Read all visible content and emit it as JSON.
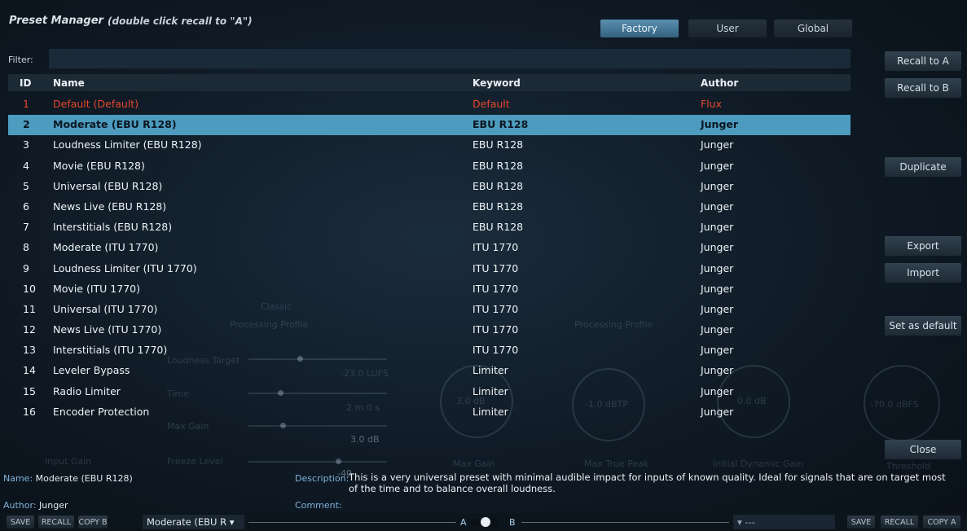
{
  "header": {
    "title": "Preset Manager",
    "subtitle": "(double click recall to \"A\")",
    "tabs": [
      {
        "label": "Factory",
        "active": true
      },
      {
        "label": "User",
        "active": false
      },
      {
        "label": "Global",
        "active": false
      }
    ]
  },
  "filter": {
    "label": "Filter:",
    "value": ""
  },
  "table": {
    "columns": {
      "id": "ID",
      "name": "Name",
      "keyword": "Keyword",
      "author": "Author"
    },
    "rows": [
      {
        "id": "1",
        "name": "Default (Default)",
        "keyword": "Default",
        "author": "Flux",
        "style": "red"
      },
      {
        "id": "2",
        "name": "Moderate (EBU R128)",
        "keyword": "EBU R128",
        "author": "Junger",
        "style": "selected"
      },
      {
        "id": "3",
        "name": "Loudness Limiter (EBU R128)",
        "keyword": "EBU R128",
        "author": "Junger",
        "style": ""
      },
      {
        "id": "4",
        "name": "Movie (EBU R128)",
        "keyword": "EBU R128",
        "author": "Junger",
        "style": ""
      },
      {
        "id": "5",
        "name": "Universal (EBU R128)",
        "keyword": "EBU R128",
        "author": "Junger",
        "style": ""
      },
      {
        "id": "6",
        "name": "News Live (EBU R128)",
        "keyword": "EBU R128",
        "author": "Junger",
        "style": ""
      },
      {
        "id": "7",
        "name": "Interstitials (EBU R128)",
        "keyword": "EBU R128",
        "author": "Junger",
        "style": ""
      },
      {
        "id": "8",
        "name": "Moderate (ITU 1770)",
        "keyword": "ITU 1770",
        "author": "Junger",
        "style": ""
      },
      {
        "id": "9",
        "name": "Loudness Limiter (ITU 1770)",
        "keyword": "ITU 1770",
        "author": "Junger",
        "style": ""
      },
      {
        "id": "10",
        "name": "Movie (ITU 1770)",
        "keyword": "ITU 1770",
        "author": "Junger",
        "style": ""
      },
      {
        "id": "11",
        "name": "Universal (ITU 1770)",
        "keyword": "ITU 1770",
        "author": "Junger",
        "style": ""
      },
      {
        "id": "12",
        "name": "News Live (ITU 1770)",
        "keyword": "ITU 1770",
        "author": "Junger",
        "style": ""
      },
      {
        "id": "13",
        "name": "Interstitials (ITU 1770)",
        "keyword": "ITU 1770",
        "author": "Junger",
        "style": ""
      },
      {
        "id": "14",
        "name": "Leveler Bypass",
        "keyword": "Limiter",
        "author": "Junger",
        "style": ""
      },
      {
        "id": "15",
        "name": "Radio Limiter",
        "keyword": "Limiter",
        "author": "Junger",
        "style": ""
      },
      {
        "id": "16",
        "name": "Encoder Protection",
        "keyword": "Limiter",
        "author": "Junger",
        "style": ""
      }
    ]
  },
  "side_buttons": {
    "recall_a": "Recall to A",
    "recall_b": "Recall to B",
    "duplicate": "Duplicate",
    "export": "Export",
    "import": "Import",
    "set_default": "Set as default",
    "close": "Close"
  },
  "info": {
    "name_label": "Name:",
    "name_value": "Moderate (EBU R128)",
    "author_label": "Author:",
    "author_value": "Junger",
    "description_label": "Description:",
    "description_value": "This is a very universal preset with minimal audible impact for inputs of known quality. Ideal for signals that are on target most of the time and to balance overall loudness.",
    "comment_label": "Comment:"
  },
  "background_ghost": {
    "loudness_target": "Loudness Target",
    "loudness_target_value": "-23.0 LUFS",
    "time": "Time",
    "time_value": "2 m 0 s",
    "max_gain": "Max Gain",
    "max_gain_value": "3.0 dB",
    "input_gain": "Input Gain",
    "freeze_level": "Freeze Level",
    "freeze_value": "-40",
    "max_gain_2": "Max Gain",
    "max_true_peak": "Max True Peak",
    "initial_dynamic_gain": "Initial Dynamic Gain",
    "knob1": "3.0 dB",
    "knob2": "-1.0 dBTP",
    "knob3": "0.0 dB",
    "knob4": "-70.0 dBFS",
    "processing_profile": "Processing Profile",
    "processing_profile_2": "Processing Profile",
    "classic": "Classic",
    "threshold": "Threshold"
  },
  "bottom_bar": {
    "save_left": "SAVE",
    "recall_left": "RECALL",
    "copy_b": "COPY B",
    "preset_select": "Moderate (EBU R ▾",
    "a_label": "A",
    "b_label": "B",
    "right_select": "▾ ---",
    "save_right": "SAVE",
    "recall_right": "RECALL",
    "copy_a": "COPY A"
  }
}
